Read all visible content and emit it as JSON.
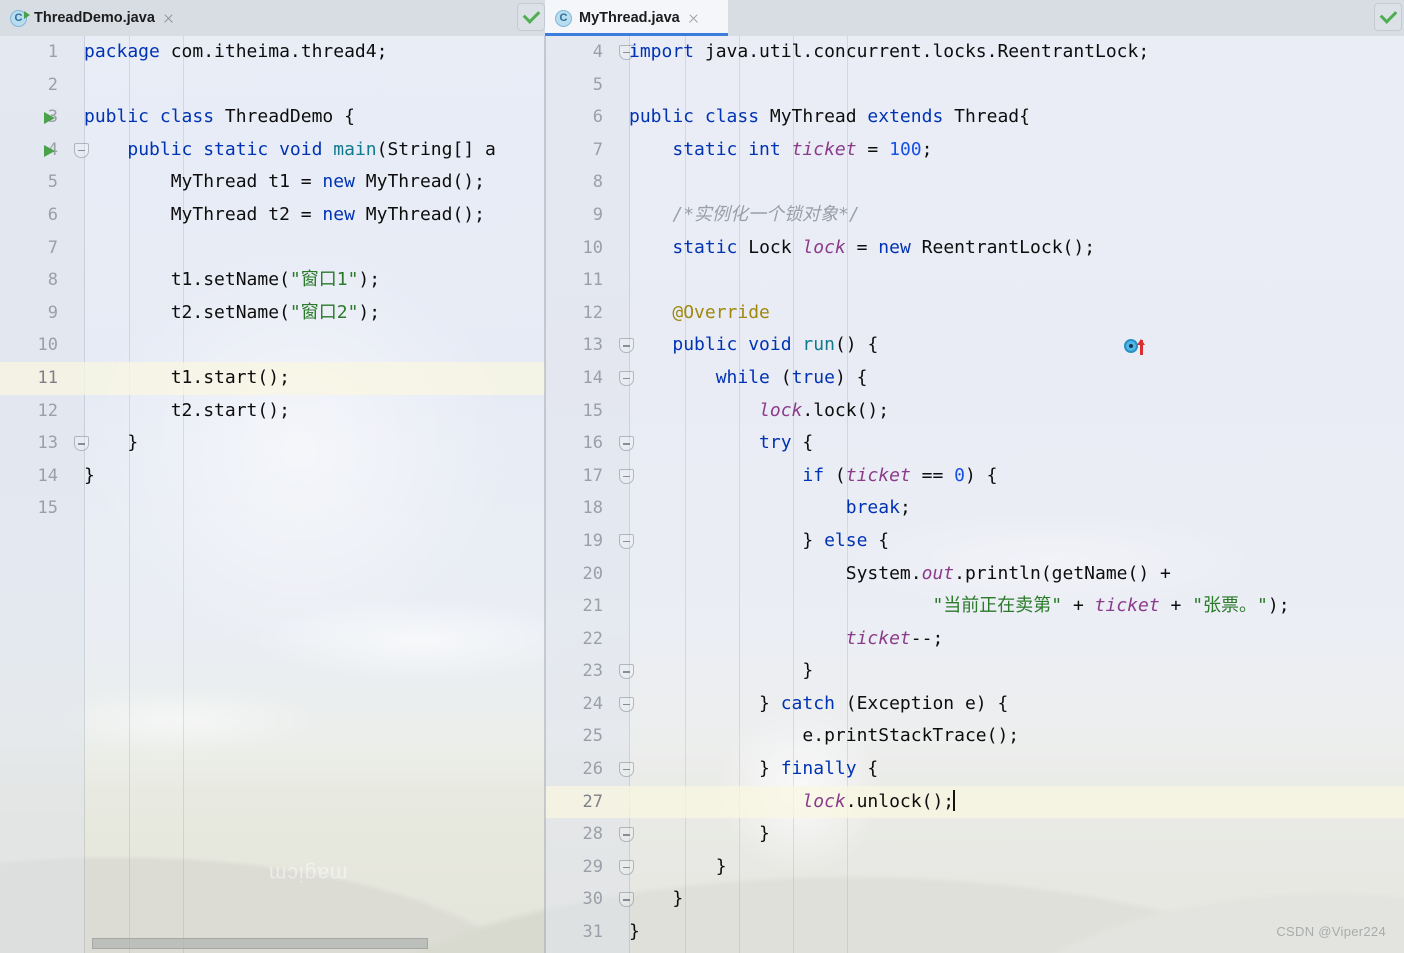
{
  "window": {
    "watermark": "CSDN @Viper224",
    "background_mark": "magicm"
  },
  "tabs": [
    {
      "label": "ThreadDemo.java",
      "icon": "java-class-runnable-icon",
      "active": false,
      "close": "close-icon"
    },
    {
      "label": "MyThread.java",
      "icon": "java-class-icon",
      "active": true,
      "close": "close-icon"
    }
  ],
  "colors": {
    "keyword": "#0033b3",
    "string": "#2a7a2a",
    "number": "#1750eb",
    "field": "#8b3b8b",
    "annotation": "#9e880d",
    "comment": "#9aa0a8",
    "method": "#0f7a8c",
    "accent": "#3b7ddd",
    "run_green": "#4aa24a",
    "check_green": "#4fae54",
    "caret_line": "#f9f7e0"
  },
  "left_editor": {
    "name": "ThreadDemo.java",
    "caret_line": 11,
    "first_line": 1,
    "inspection_status": "ok",
    "lines": [
      {
        "n": 1,
        "tokens": [
          {
            "t": "kw",
            "v": "package"
          },
          {
            "t": "txt",
            "v": " com.itheima.thread4;"
          }
        ]
      },
      {
        "n": 2,
        "tokens": []
      },
      {
        "n": 3,
        "gutter": "run",
        "tokens": [
          {
            "t": "kw",
            "v": "public class"
          },
          {
            "t": "txt",
            "v": " ThreadDemo {"
          }
        ]
      },
      {
        "n": 4,
        "gutter": "run",
        "fold": true,
        "tokens": [
          {
            "t": "txt",
            "v": "    "
          },
          {
            "t": "kw",
            "v": "public static void"
          },
          {
            "t": "meth",
            "v": " main"
          },
          {
            "t": "txt",
            "v": "(String[] a"
          }
        ]
      },
      {
        "n": 5,
        "tokens": [
          {
            "t": "txt",
            "v": "        MyThread t1 = "
          },
          {
            "t": "kw",
            "v": "new"
          },
          {
            "t": "txt",
            "v": " MyThread();"
          }
        ]
      },
      {
        "n": 6,
        "tokens": [
          {
            "t": "txt",
            "v": "        MyThread t2 = "
          },
          {
            "t": "kw",
            "v": "new"
          },
          {
            "t": "txt",
            "v": " MyThread();"
          }
        ]
      },
      {
        "n": 7,
        "tokens": []
      },
      {
        "n": 8,
        "tokens": [
          {
            "t": "txt",
            "v": "        t1.setName("
          },
          {
            "t": "str",
            "v": "\"窗口1\""
          },
          {
            "t": "txt",
            "v": ");"
          }
        ]
      },
      {
        "n": 9,
        "tokens": [
          {
            "t": "txt",
            "v": "        t2.setName("
          },
          {
            "t": "str",
            "v": "\"窗口2\""
          },
          {
            "t": "txt",
            "v": ");"
          }
        ]
      },
      {
        "n": 10,
        "tokens": []
      },
      {
        "n": 11,
        "caret": true,
        "tokens": [
          {
            "t": "txt",
            "v": "        t1.start();"
          }
        ]
      },
      {
        "n": 12,
        "tokens": [
          {
            "t": "txt",
            "v": "        t2.start();"
          }
        ]
      },
      {
        "n": 13,
        "fold": true,
        "tokens": [
          {
            "t": "txt",
            "v": "    }"
          }
        ]
      },
      {
        "n": 14,
        "tokens": [
          {
            "t": "txt",
            "v": "}"
          }
        ]
      },
      {
        "n": 15,
        "tokens": []
      }
    ]
  },
  "right_editor": {
    "name": "MyThread.java",
    "caret_line": 27,
    "first_line": 4,
    "inspection_status": "ok",
    "lines": [
      {
        "n": 4,
        "fold": true,
        "tokens": [
          {
            "t": "kw",
            "v": "import"
          },
          {
            "t": "txt",
            "v": " java.util.concurrent.locks.ReentrantLock;"
          }
        ]
      },
      {
        "n": 5,
        "tokens": []
      },
      {
        "n": 6,
        "tokens": [
          {
            "t": "kw",
            "v": "public class"
          },
          {
            "t": "txt",
            "v": " MyThread "
          },
          {
            "t": "kw",
            "v": "extends"
          },
          {
            "t": "txt",
            "v": " Thread{"
          }
        ]
      },
      {
        "n": 7,
        "tokens": [
          {
            "t": "txt",
            "v": "    "
          },
          {
            "t": "kw",
            "v": "static int"
          },
          {
            "t": "fld",
            "v": " ticket"
          },
          {
            "t": "txt",
            "v": " = "
          },
          {
            "t": "num",
            "v": "100"
          },
          {
            "t": "txt",
            "v": ";"
          }
        ]
      },
      {
        "n": 8,
        "tokens": []
      },
      {
        "n": 9,
        "tokens": [
          {
            "t": "txt",
            "v": "    "
          },
          {
            "t": "cmt",
            "v": "/*实例化一个锁对象*/"
          }
        ]
      },
      {
        "n": 10,
        "tokens": [
          {
            "t": "txt",
            "v": "    "
          },
          {
            "t": "kw",
            "v": "static"
          },
          {
            "t": "txt",
            "v": " Lock "
          },
          {
            "t": "fld",
            "v": "lock"
          },
          {
            "t": "txt",
            "v": " = "
          },
          {
            "t": "kw",
            "v": "new"
          },
          {
            "t": "txt",
            "v": " ReentrantLock();"
          }
        ]
      },
      {
        "n": 11,
        "tokens": []
      },
      {
        "n": 12,
        "tokens": [
          {
            "t": "txt",
            "v": "    "
          },
          {
            "t": "anno",
            "v": "@Override"
          }
        ]
      },
      {
        "n": 13,
        "gutter": "override",
        "fold": true,
        "tokens": [
          {
            "t": "txt",
            "v": "    "
          },
          {
            "t": "kw",
            "v": "public void"
          },
          {
            "t": "meth",
            "v": " run"
          },
          {
            "t": "txt",
            "v": "() {"
          }
        ]
      },
      {
        "n": 14,
        "fold": true,
        "tokens": [
          {
            "t": "txt",
            "v": "        "
          },
          {
            "t": "kw",
            "v": "while"
          },
          {
            "t": "txt",
            "v": " ("
          },
          {
            "t": "kw",
            "v": "true"
          },
          {
            "t": "txt",
            "v": ") {"
          }
        ]
      },
      {
        "n": 15,
        "tokens": [
          {
            "t": "txt",
            "v": "            "
          },
          {
            "t": "fld",
            "v": "lock"
          },
          {
            "t": "txt",
            "v": ".lock();"
          }
        ]
      },
      {
        "n": 16,
        "fold": true,
        "tokens": [
          {
            "t": "txt",
            "v": "            "
          },
          {
            "t": "kw",
            "v": "try"
          },
          {
            "t": "txt",
            "v": " {"
          }
        ]
      },
      {
        "n": 17,
        "fold": true,
        "tokens": [
          {
            "t": "txt",
            "v": "                "
          },
          {
            "t": "kw",
            "v": "if"
          },
          {
            "t": "txt",
            "v": " ("
          },
          {
            "t": "fld",
            "v": "ticket"
          },
          {
            "t": "txt",
            "v": " == "
          },
          {
            "t": "num",
            "v": "0"
          },
          {
            "t": "txt",
            "v": ") {"
          }
        ]
      },
      {
        "n": 18,
        "tokens": [
          {
            "t": "txt",
            "v": "                    "
          },
          {
            "t": "kw",
            "v": "break"
          },
          {
            "t": "txt",
            "v": ";"
          }
        ]
      },
      {
        "n": 19,
        "fold": true,
        "tokens": [
          {
            "t": "txt",
            "v": "                } "
          },
          {
            "t": "kw",
            "v": "else"
          },
          {
            "t": "txt",
            "v": " {"
          }
        ]
      },
      {
        "n": 20,
        "tokens": [
          {
            "t": "txt",
            "v": "                    System."
          },
          {
            "t": "fld",
            "v": "out"
          },
          {
            "t": "txt",
            "v": ".println(getName() +"
          }
        ]
      },
      {
        "n": 21,
        "tokens": [
          {
            "t": "txt",
            "v": "                            "
          },
          {
            "t": "str",
            "v": "\"当前正在卖第\""
          },
          {
            "t": "txt",
            "v": " + "
          },
          {
            "t": "fld",
            "v": "ticket"
          },
          {
            "t": "txt",
            "v": " + "
          },
          {
            "t": "str",
            "v": "\"张票。\""
          },
          {
            "t": "txt",
            "v": ");"
          }
        ]
      },
      {
        "n": 22,
        "tokens": [
          {
            "t": "txt",
            "v": "                    "
          },
          {
            "t": "fld",
            "v": "ticket"
          },
          {
            "t": "txt",
            "v": "--;"
          }
        ]
      },
      {
        "n": 23,
        "fold": true,
        "tokens": [
          {
            "t": "txt",
            "v": "                }"
          }
        ]
      },
      {
        "n": 24,
        "fold": true,
        "tokens": [
          {
            "t": "txt",
            "v": "            } "
          },
          {
            "t": "kw",
            "v": "catch"
          },
          {
            "t": "txt",
            "v": " (Exception e) {"
          }
        ]
      },
      {
        "n": 25,
        "tokens": [
          {
            "t": "txt",
            "v": "                e.printStackTrace();"
          }
        ]
      },
      {
        "n": 26,
        "fold": true,
        "tokens": [
          {
            "t": "txt",
            "v": "            } "
          },
          {
            "t": "kw",
            "v": "finally"
          },
          {
            "t": "txt",
            "v": " {"
          }
        ]
      },
      {
        "n": 27,
        "caret": true,
        "tokens": [
          {
            "t": "txt",
            "v": "                "
          },
          {
            "t": "fld",
            "v": "lock"
          },
          {
            "t": "txt",
            "v": ".unlock();"
          },
          {
            "t": "caret",
            "v": ""
          }
        ]
      },
      {
        "n": 28,
        "fold": true,
        "tokens": [
          {
            "t": "txt",
            "v": "            }"
          }
        ]
      },
      {
        "n": 29,
        "fold": true,
        "tokens": [
          {
            "t": "txt",
            "v": "        }"
          }
        ]
      },
      {
        "n": 30,
        "fold": true,
        "tokens": [
          {
            "t": "txt",
            "v": "    }"
          }
        ]
      },
      {
        "n": 31,
        "tokens": [
          {
            "t": "txt",
            "v": "}"
          }
        ]
      }
    ]
  }
}
